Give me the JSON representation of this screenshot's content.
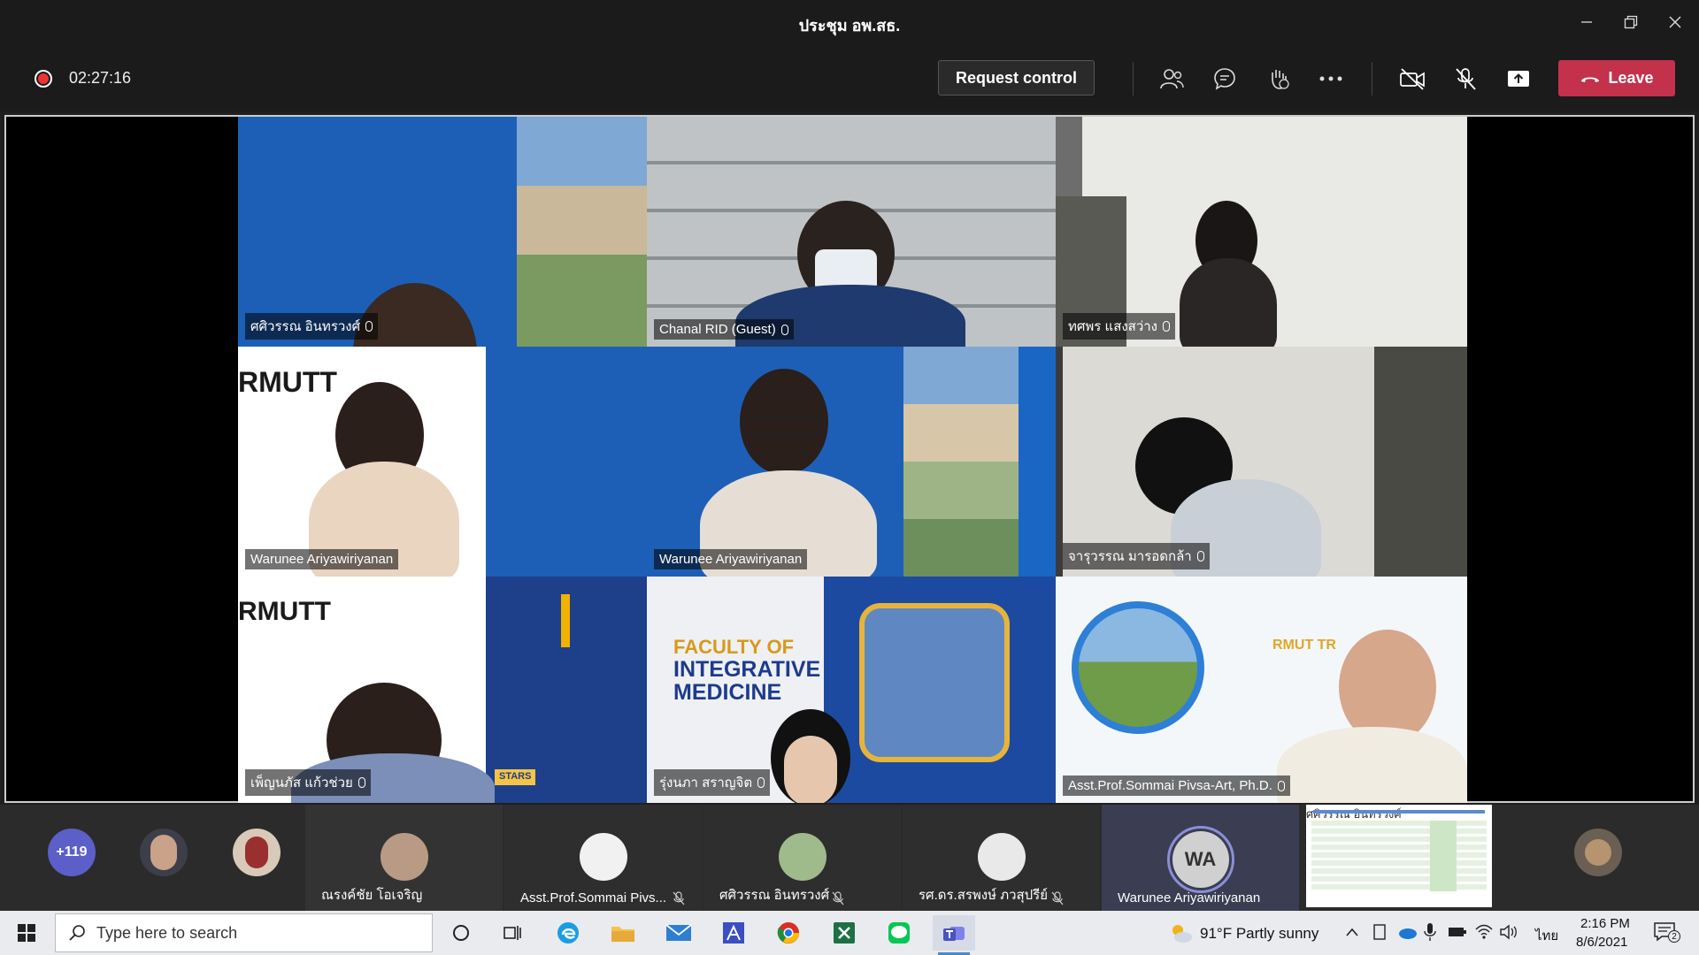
{
  "window": {
    "title": "ประชุม อพ.สธ."
  },
  "toolbar": {
    "timer": "02:27:16",
    "request_control": "Request control",
    "leave": "Leave"
  },
  "tiles": [
    {
      "name": "ศศิวรรณ อินทรวงศ์"
    },
    {
      "name": "Chanal RID (Guest)"
    },
    {
      "name": "ทศพร แสงสว่าง"
    },
    {
      "name": "Warunee Ariyawiriyanan",
      "logo_text": "RMUTT"
    },
    {
      "name": "Warunee Ariyawiriyanan"
    },
    {
      "name": "จารุวรรณ มารอดกล้า"
    },
    {
      "name": "เพ็ญนภัส แก้วช่วย",
      "logo_text": "RMUTT",
      "badge": "STARS"
    },
    {
      "name": "รุ่งนภา สราญจิต",
      "line1": "FACULTY OF",
      "line2": "INTEGRATIVE",
      "line3": "MEDICINE"
    },
    {
      "name": "Asst.Prof.Sommai Pivsa-Art, Ph.D.",
      "logo_text": "RMUT TR"
    }
  ],
  "roster": {
    "overflow_count": "+119",
    "participants": [
      {
        "name": "ณรงค์ชัย โอเจริญ"
      },
      {
        "name": "Asst.Prof.Sommai Pivs..."
      },
      {
        "name": "ศศิวรรณ อินทรวงศ์"
      },
      {
        "name": "รศ.ดร.สรพงษ์ ภวสุปรีย์"
      },
      {
        "name": "Warunee Ariyawiriyanan",
        "initials": "WA"
      },
      {
        "name": "ศศิวรรณ อินทรวงศ์"
      }
    ]
  },
  "taskbar": {
    "search_placeholder": "Type here to search",
    "weather": "91°F  Partly sunny",
    "lang": "ไทย",
    "time": "2:16 PM",
    "date": "8/6/2021",
    "notif_count": "2"
  },
  "colors": {
    "leave": "#c4314b",
    "rec": "#ee3333",
    "accent": "#8a8fd8"
  }
}
